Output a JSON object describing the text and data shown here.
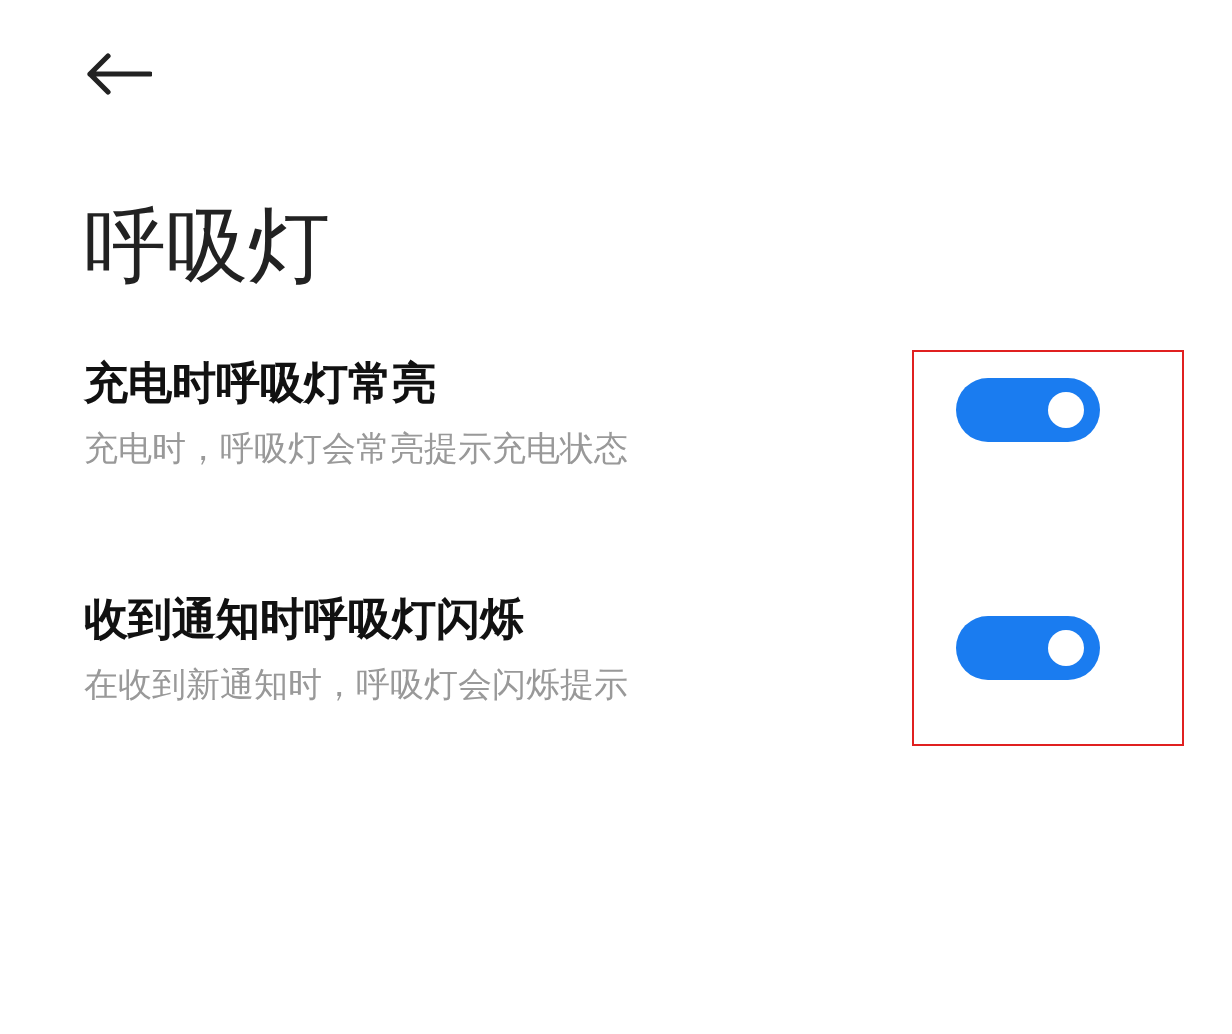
{
  "title": "呼吸灯",
  "items": [
    {
      "title": "充电时呼吸灯常亮",
      "subtitle": "充电时，呼吸灯会常亮提示充电状态",
      "on": true
    },
    {
      "title": "收到通知时呼吸灯闪烁",
      "subtitle": "在收到新通知时，呼吸灯会闪烁提示",
      "on": true
    }
  ],
  "highlight_frame": true
}
